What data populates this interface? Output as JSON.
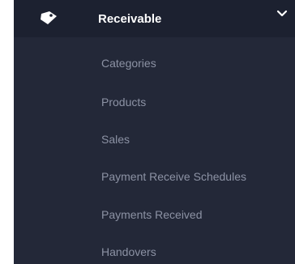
{
  "menu": {
    "title": "Receivable",
    "icon": "tag-icon",
    "expand_icon": "chevron-down-icon",
    "items": [
      {
        "label": "Categories"
      },
      {
        "label": "Products"
      },
      {
        "label": "Sales"
      },
      {
        "label": "Payment Receive Schedules"
      },
      {
        "label": "Payments Received"
      },
      {
        "label": "Handovers"
      }
    ]
  },
  "colors": {
    "sidebar_bg": "#232838",
    "header_bg": "#1c2130",
    "header_text": "#ffffff",
    "item_text": "#8c92a4"
  }
}
